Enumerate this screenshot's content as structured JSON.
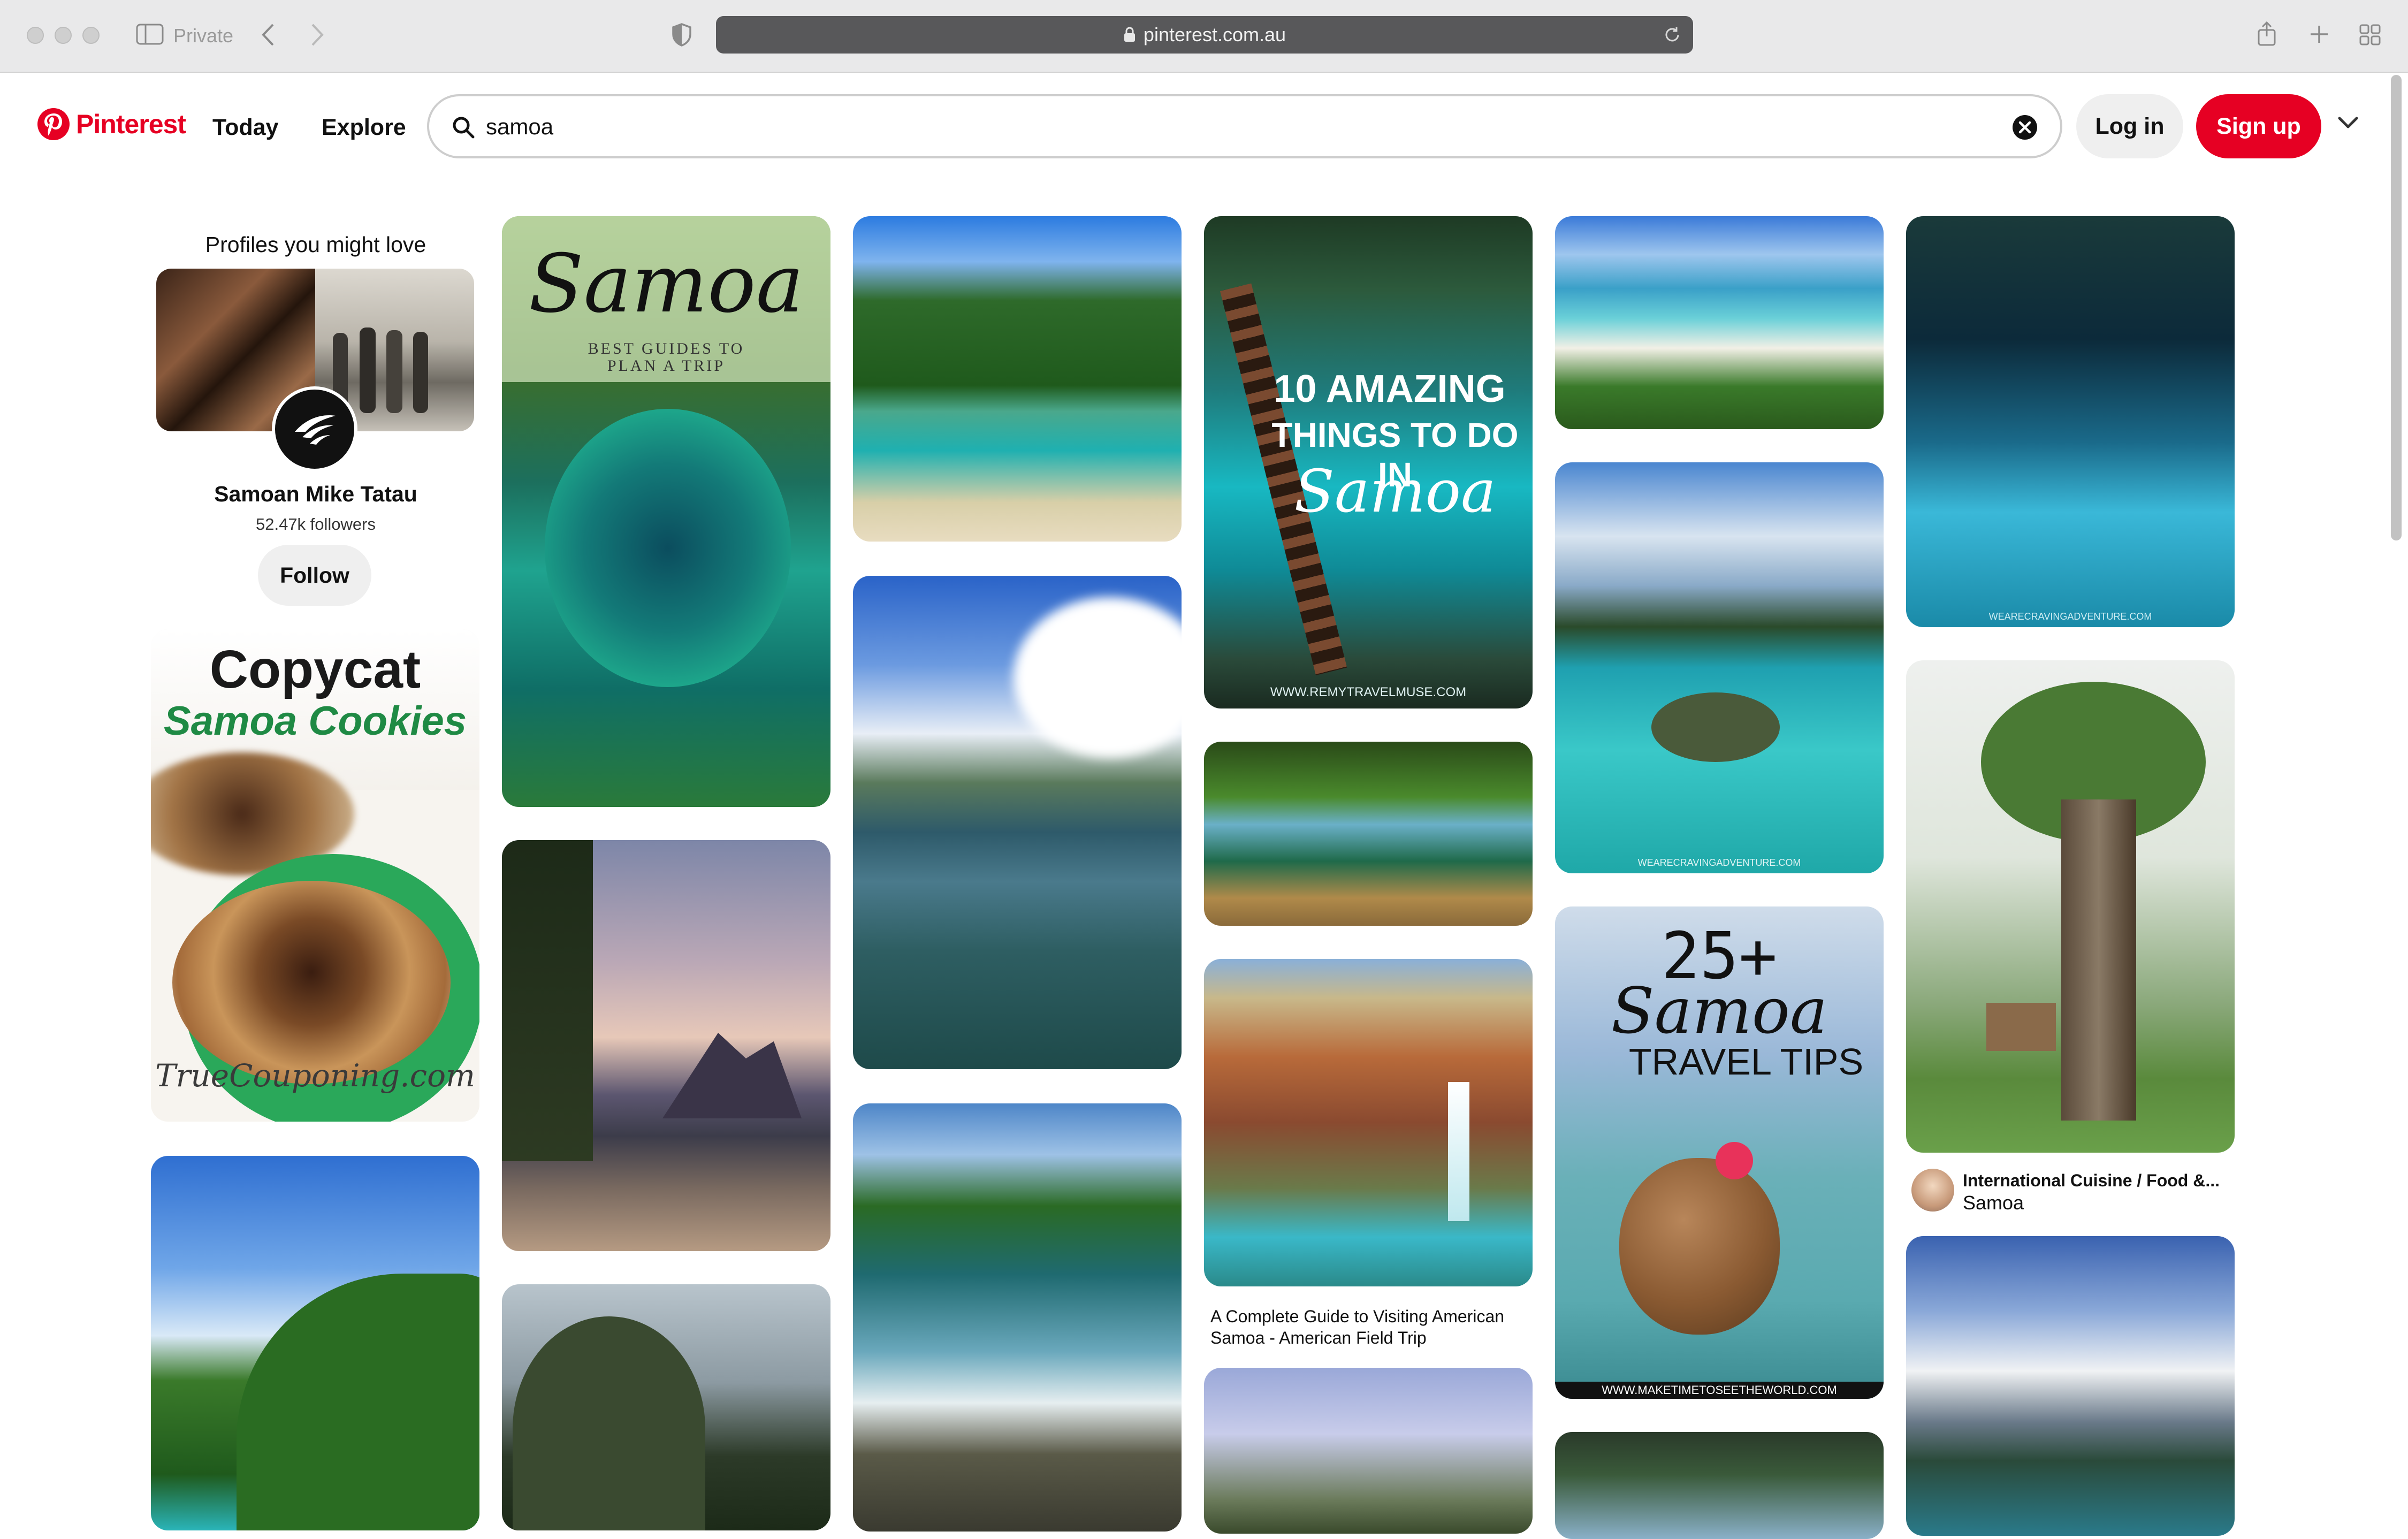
{
  "browser": {
    "private_label": "Private",
    "url": "pinterest.com.au"
  },
  "header": {
    "logo_text": "Pinterest",
    "nav": [
      "Today",
      "Explore"
    ],
    "search_value": "samoa",
    "login_label": "Log in",
    "signup_label": "Sign up",
    "brand_color": "#e60023"
  },
  "profile_card": {
    "title": "Profiles you might love",
    "name": "Samoan Mike Tatau",
    "followers": "52.47k followers",
    "follow_label": "Follow"
  },
  "pins": {
    "cookies": {
      "line1": "Copycat",
      "line2": "Samoa Cookies",
      "watermark": "TrueCouponing.com"
    },
    "guides": {
      "title": "Samoa",
      "subtitle": "BEST GUIDES TO PLAN A TRIP"
    },
    "amazing": {
      "line1": "10 AMAZING",
      "line2": "THINGS TO DO IN",
      "line3": "Samoa",
      "watermark": "WWW.REMYTRAVELMUSE.COM"
    },
    "turtle_watermark": "WEARECRAVINGADVENTURE.COM",
    "cave_watermark": "WEARECRAVINGADVENTURE.COM",
    "tips": {
      "line1": "25+",
      "line2": "Samoa",
      "line3": "TRAVEL TIPS",
      "watermark": "WWW.MAKETIMETOSEETHEWORLD.COM"
    },
    "havasu_caption": "A Complete Guide to Visiting American Samoa - American Field Trip",
    "tree_author": "International Cuisine / Food &...",
    "tree_board": "Samoa"
  }
}
